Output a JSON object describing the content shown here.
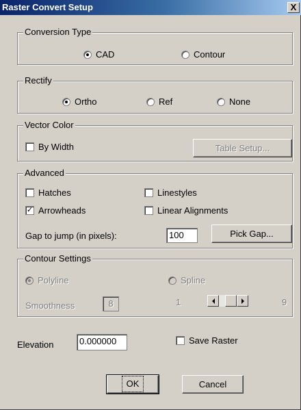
{
  "window": {
    "title": "Raster Convert Setup",
    "close_glyph": "X"
  },
  "conversion_type": {
    "legend": "Conversion Type",
    "options": [
      {
        "label": "CAD",
        "selected": true
      },
      {
        "label": "Contour",
        "selected": false
      }
    ]
  },
  "rectify": {
    "legend": "Rectify",
    "options": [
      {
        "label": "Ortho",
        "selected": true
      },
      {
        "label": "Ref",
        "selected": false
      },
      {
        "label": "None",
        "selected": false
      }
    ]
  },
  "vector_color": {
    "legend": "Vector Color",
    "by_width_label": "By Width",
    "by_width_checked": false,
    "table_setup_label": "Table Setup..."
  },
  "advanced": {
    "legend": "Advanced",
    "hatches_label": "Hatches",
    "hatches_checked": false,
    "linestyles_label": "Linestyles",
    "linestyles_checked": false,
    "arrowheads_label": "Arrowheads",
    "arrowheads_checked": true,
    "linear_alignments_label": "Linear Alignments",
    "linear_alignments_checked": false,
    "gap_label": "Gap to jump (in pixels):",
    "gap_value": "100",
    "pick_gap_label": "Pick Gap..."
  },
  "contour_settings": {
    "legend": "Contour Settings",
    "polyline_label": "Polyline",
    "polyline_selected": true,
    "spline_label": "Spline",
    "spline_selected": false,
    "smoothness_label": "Smoothness",
    "smoothness_value": "8",
    "range_min": "1",
    "range_max": "9"
  },
  "elevation": {
    "label": "Elevation",
    "value": "0.000000"
  },
  "save_raster": {
    "label": "Save Raster",
    "checked": false
  },
  "buttons": {
    "ok": "OK",
    "cancel": "Cancel"
  },
  "check_glyph": "✓"
}
